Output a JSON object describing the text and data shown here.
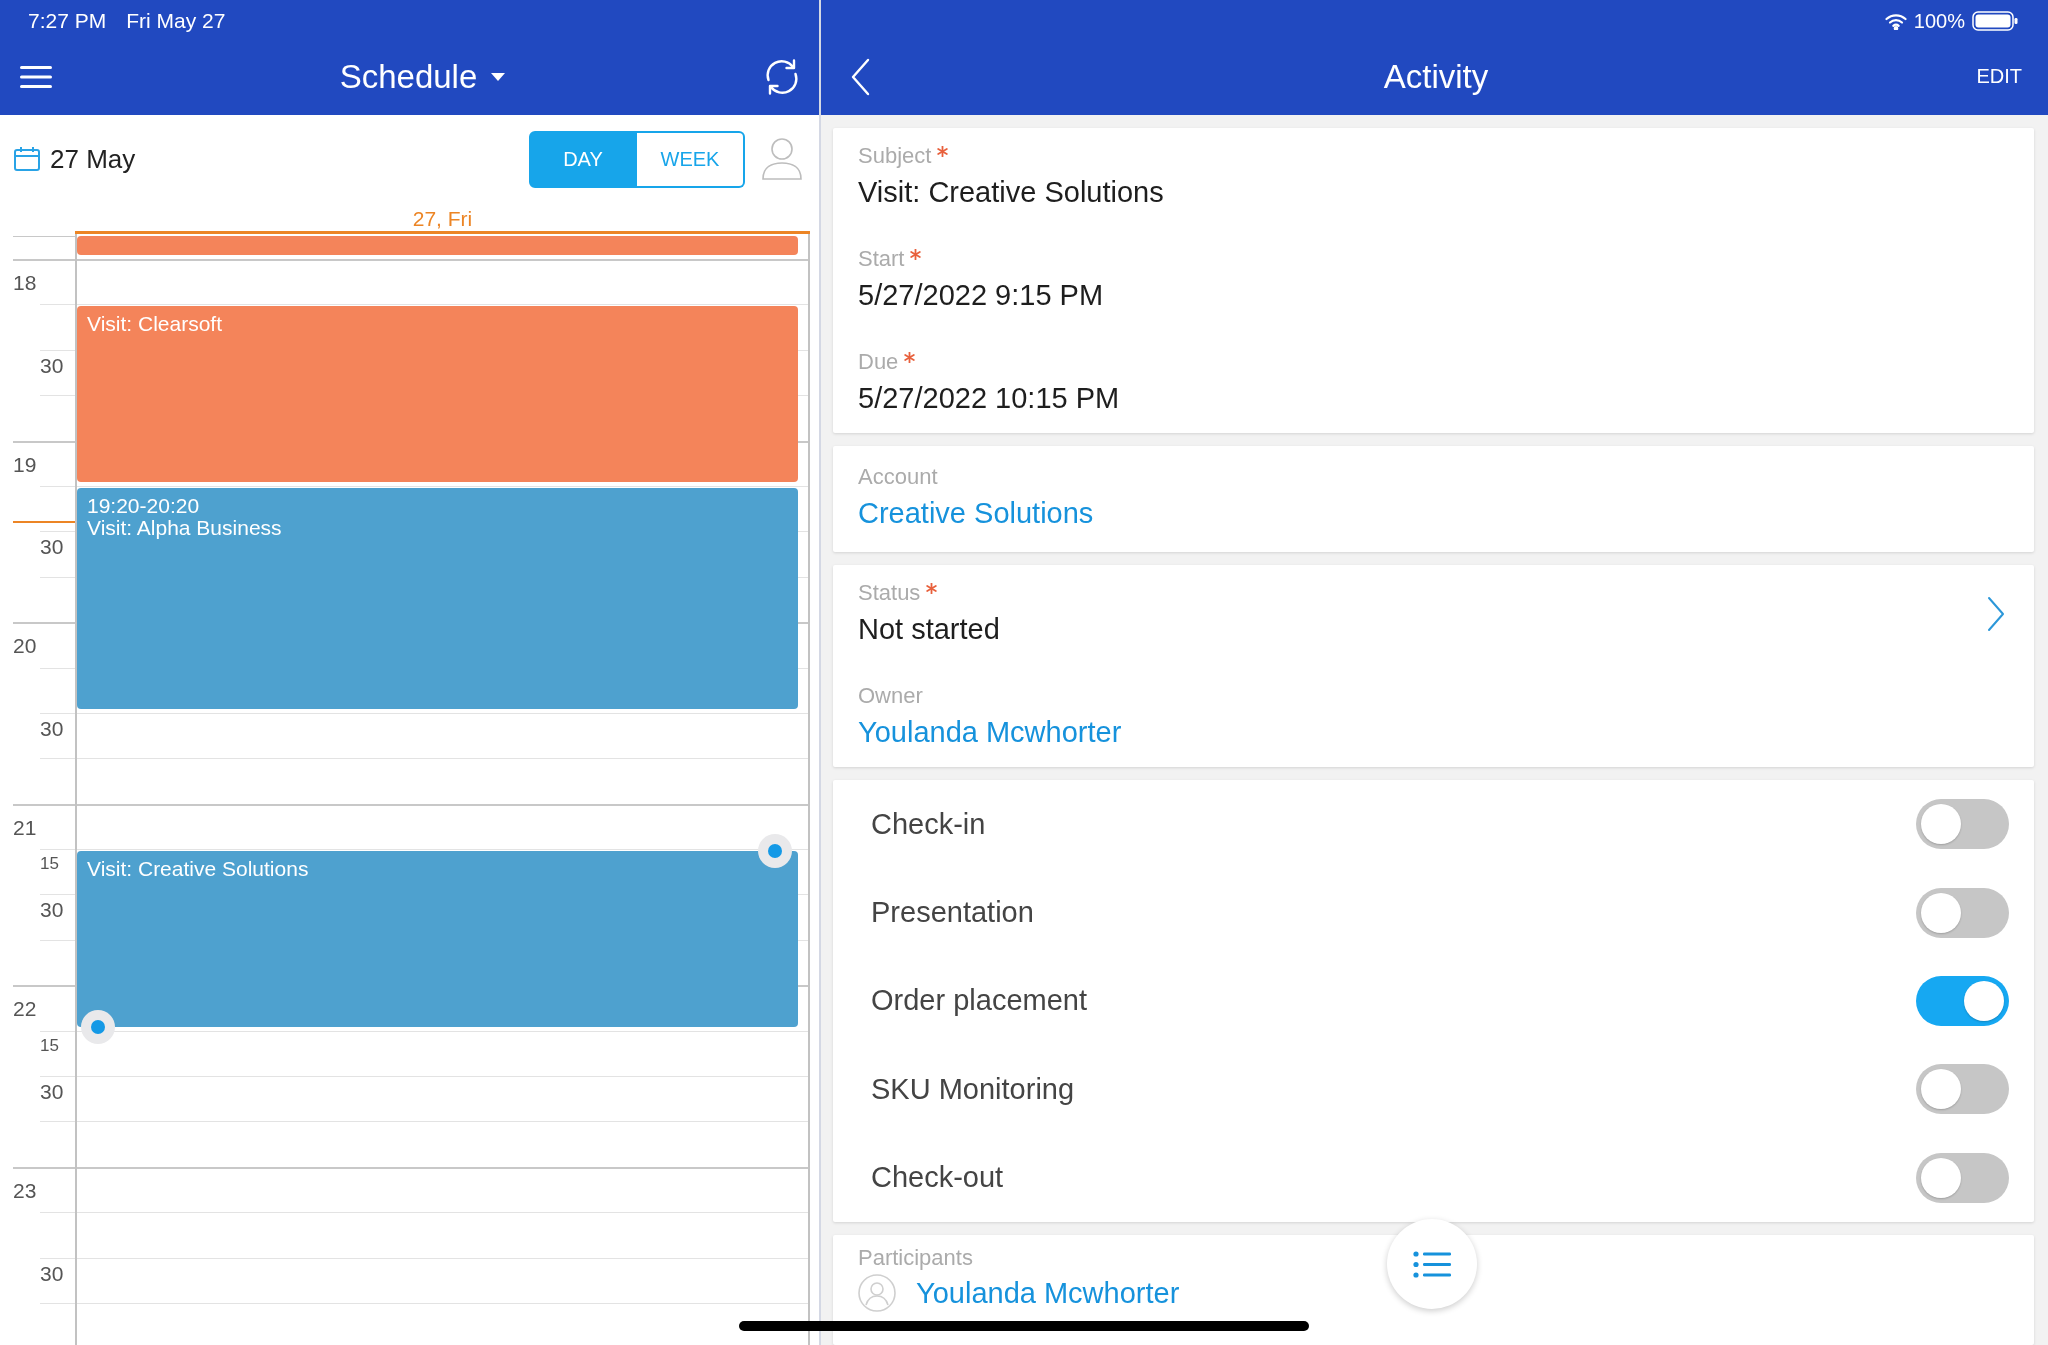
{
  "status_bar": {
    "time": "7:27 PM",
    "date": "Fri May 27",
    "battery": "100%"
  },
  "schedule": {
    "title": "Schedule",
    "date": "27 May",
    "view_tabs": [
      {
        "label": "DAY",
        "selected": true
      },
      {
        "label": "WEEK",
        "selected": false
      }
    ],
    "day_label": "27, Fri"
  },
  "calendar": {
    "hours": [
      {
        "label": "18",
        "marks": [
          {
            "text": "30",
            "kind": "half"
          }
        ]
      },
      {
        "label": "19",
        "marks": [
          {
            "text": "30",
            "kind": "half"
          }
        ]
      },
      {
        "label": "20",
        "marks": [
          {
            "text": "30",
            "kind": "half"
          }
        ]
      },
      {
        "label": "21",
        "marks": [
          {
            "text": "15",
            "kind": "quarter"
          },
          {
            "text": "30",
            "kind": "half"
          }
        ]
      },
      {
        "label": "22",
        "marks": [
          {
            "text": "15",
            "kind": "quarter"
          },
          {
            "text": "30",
            "kind": "half"
          }
        ]
      },
      {
        "label": "23",
        "marks": [
          {
            "text": "30",
            "kind": "half"
          }
        ]
      }
    ],
    "events": [
      {
        "color": "#f4845a",
        "selected": false
      },
      {
        "title": "Visit: Clearsoft",
        "color": "#f4845a",
        "selected": false
      },
      {
        "time": "19:20-20:20",
        "title": "Visit: Alpha Business",
        "color": "#4ea1cf",
        "selected": false
      },
      {
        "title": "Visit: Creative Solutions",
        "color": "#4ea1cf",
        "selected": true
      }
    ]
  },
  "activity": {
    "title": "Activity",
    "edit": "EDIT",
    "sections": [
      {
        "fields": [
          {
            "label": "Subject",
            "required": true,
            "value": "Visit: Creative Solutions",
            "kind": "text"
          },
          {
            "label": "Start",
            "required": true,
            "value": "5/27/2022 9:15 PM",
            "kind": "text"
          },
          {
            "label": "Due",
            "required": true,
            "value": "5/27/2022 10:15 PM",
            "kind": "text"
          }
        ]
      },
      {
        "fields": [
          {
            "label": "Account",
            "required": false,
            "value": "Creative Solutions",
            "kind": "link"
          }
        ]
      },
      {
        "fields": [
          {
            "label": "Status",
            "required": true,
            "value": "Not started",
            "kind": "select"
          },
          {
            "label": "Owner",
            "required": false,
            "value": "Youlanda Mcwhorter",
            "kind": "link"
          }
        ]
      }
    ],
    "toggles": [
      {
        "label": "Check-in",
        "on": false
      },
      {
        "label": "Presentation",
        "on": false
      },
      {
        "label": "Order placement",
        "on": true
      },
      {
        "label": "SKU Monitoring",
        "on": false
      },
      {
        "label": "Check-out",
        "on": false
      }
    ],
    "participants": {
      "label": "Participants",
      "people": [
        {
          "name": "Youlanda Mcwhorter"
        }
      ]
    }
  }
}
